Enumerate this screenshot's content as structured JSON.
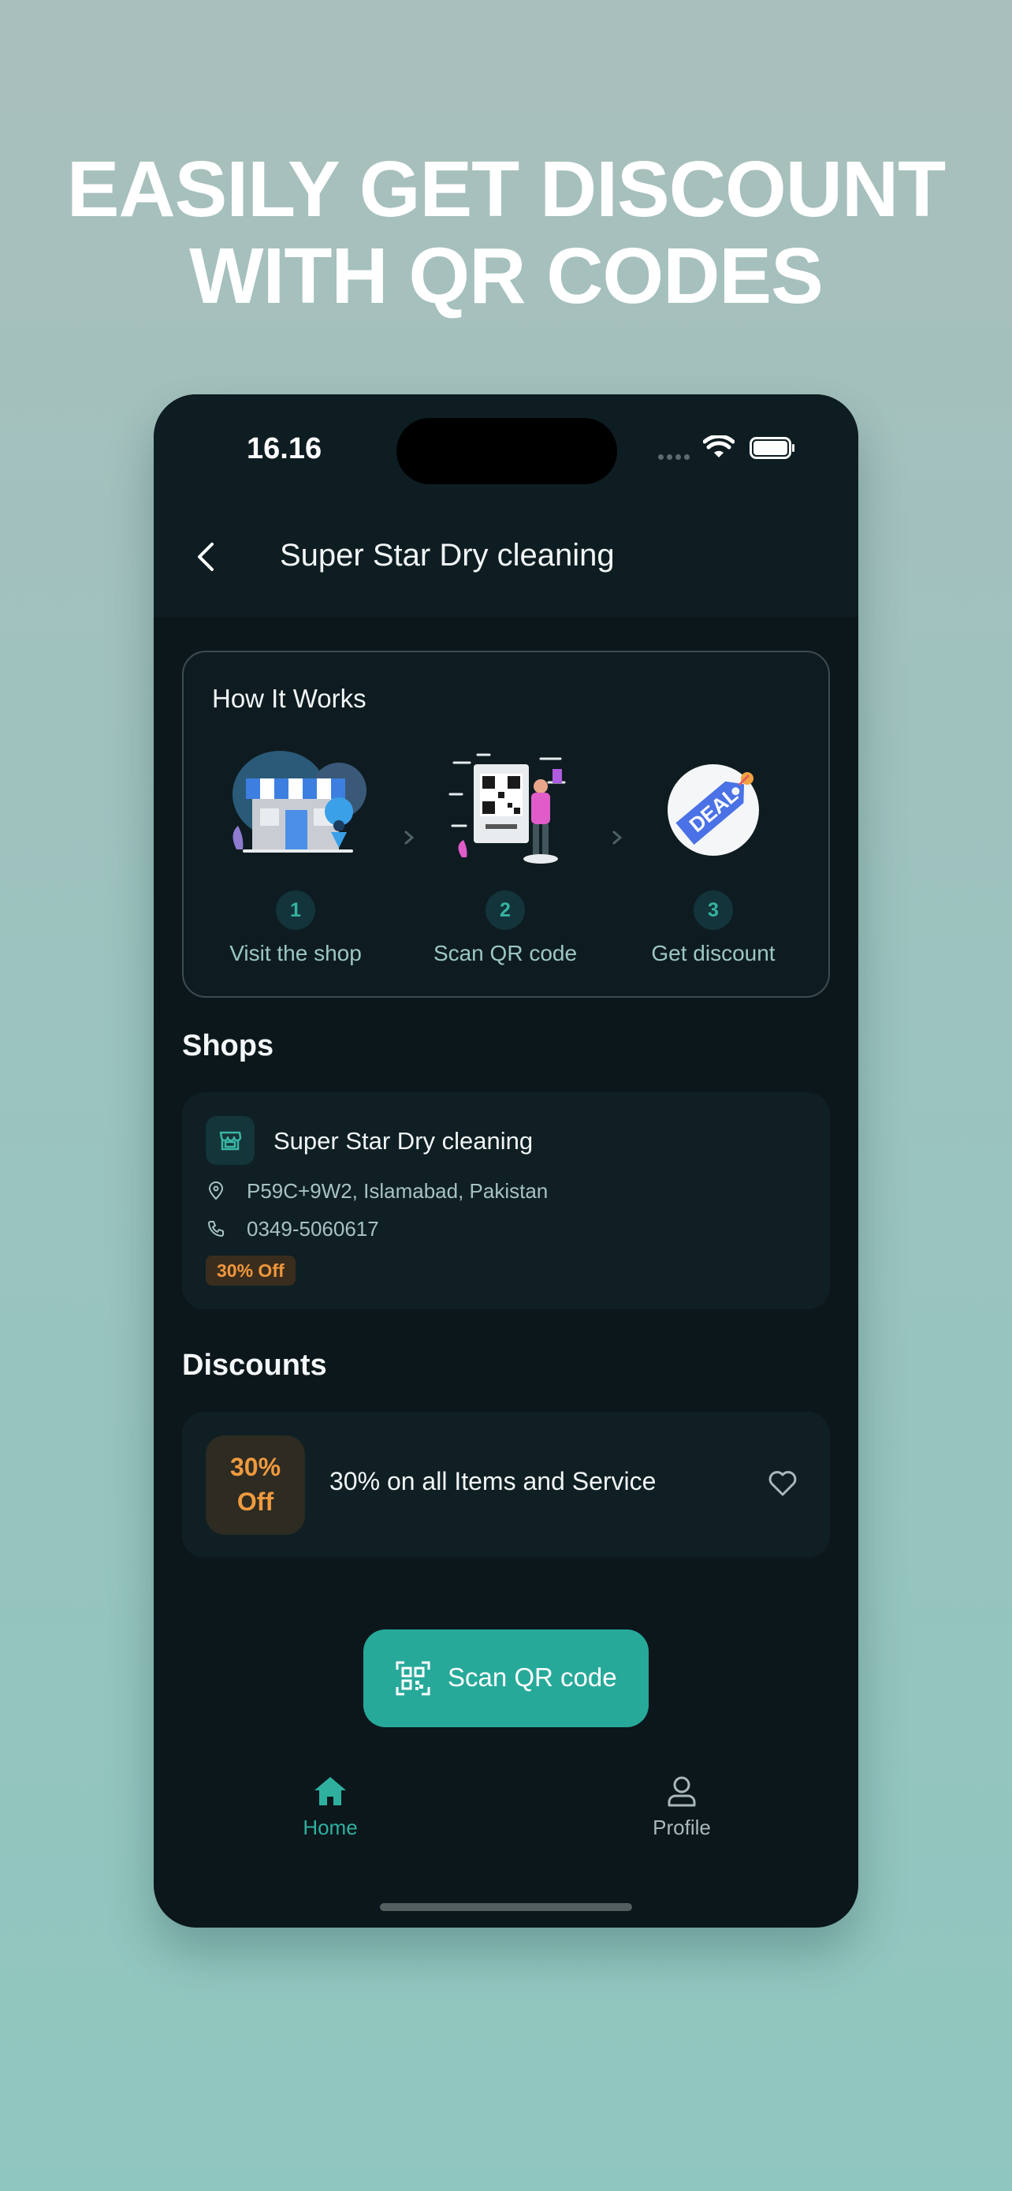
{
  "headline": {
    "line1": "EASILY GET DISCOUNT",
    "line2": "WITH QR CODES"
  },
  "status_bar": {
    "time": "16.16"
  },
  "nav": {
    "title": "Super Star Dry cleaning"
  },
  "how_it_works": {
    "title": "How It Works",
    "steps": [
      {
        "num": "1",
        "label": "Visit the shop",
        "icon": "shop-illustration"
      },
      {
        "num": "2",
        "label": "Scan QR code",
        "icon": "qr-scan-illustration"
      },
      {
        "num": "3",
        "label": "Get discount",
        "icon": "deal-tag-illustration"
      }
    ]
  },
  "shops": {
    "title": "Shops",
    "items": [
      {
        "name": "Super Star Dry cleaning",
        "address": "P59C+9W2, Islamabad, Pakistan",
        "phone": "0349-5060617",
        "badge": "30% Off"
      }
    ]
  },
  "discounts": {
    "title": "Discounts",
    "items": [
      {
        "badge_line1": "30%",
        "badge_line2": "Off",
        "text": "30% on all Items and Service"
      }
    ]
  },
  "scan_button": {
    "label": "Scan QR code"
  },
  "tabs": [
    {
      "label": "Home",
      "icon": "home-icon",
      "active": true
    },
    {
      "label": "Profile",
      "icon": "profile-icon",
      "active": false
    }
  ],
  "colors": {
    "accent": "#27a99a",
    "screen_bg": "#0b171b",
    "card_bg": "#0f1f24",
    "discount_orange": "#ef9a3e"
  }
}
